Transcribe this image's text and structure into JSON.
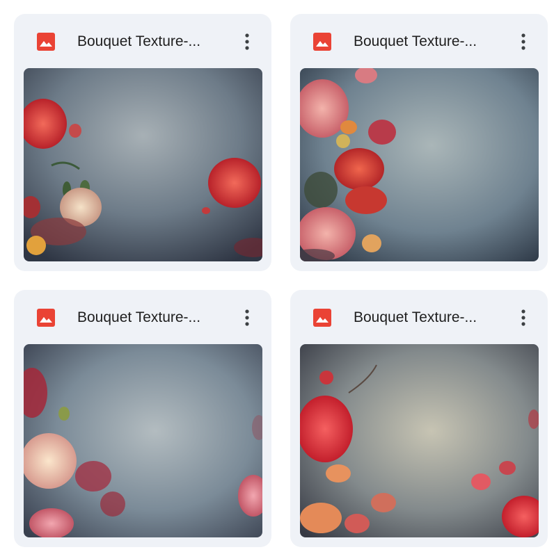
{
  "files": [
    {
      "name": "Bouquet Texture-...",
      "icon": "image-file-icon"
    },
    {
      "name": "Bouquet Texture-...",
      "icon": "image-file-icon"
    },
    {
      "name": "Bouquet Texture-...",
      "icon": "image-file-icon"
    },
    {
      "name": "Bouquet Texture-...",
      "icon": "image-file-icon"
    }
  ],
  "colors": {
    "card_bg": "#eff2f7",
    "icon_red": "#ea4335",
    "title_text": "#1f1f1f"
  }
}
